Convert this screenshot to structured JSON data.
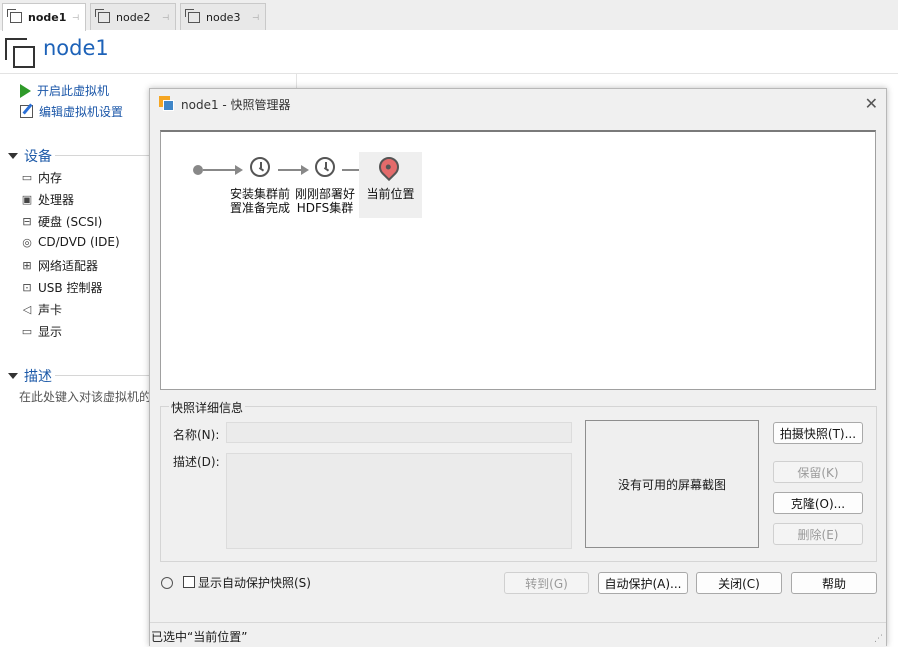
{
  "tabs": [
    {
      "label": "node1",
      "active": true
    },
    {
      "label": "node2",
      "active": false
    },
    {
      "label": "node3",
      "active": false
    }
  ],
  "header": {
    "title": "node1"
  },
  "actions": {
    "start_vm": "开启此虚拟机",
    "edit_vm": "编辑虚拟机设置"
  },
  "devices": {
    "section_title": "设备",
    "items": [
      "内存",
      "处理器",
      "硬盘 (SCSI)",
      "CD/DVD (IDE)",
      "网络适配器",
      "USB 控制器",
      "声卡",
      "显示"
    ],
    "icons": [
      "memory-icon",
      "processor-icon",
      "hard-disk-icon",
      "cd-dvd-icon",
      "network-adapter-icon",
      "usb-icon",
      "sound-card-icon",
      "display-icon"
    ]
  },
  "description": {
    "section_title": "描述",
    "placeholder": "在此处键入对该虚拟机的描述。"
  },
  "dialog": {
    "title": "node1 - 快照管理器",
    "snapshots": [
      {
        "line1": "安装集群前",
        "line2": "置准备完成"
      },
      {
        "line1": "刚刚部署好",
        "line2": "HDFS集群"
      }
    ],
    "current_location": "当前位置",
    "details": {
      "group_title": "快照详细信息",
      "name_label": "名称(N):",
      "name_value": "",
      "desc_label": "描述(D):",
      "desc_value": "",
      "no_screenshot": "没有可用的屏幕截图"
    },
    "side_buttons": {
      "take_snapshot": "拍摄快照(T)...",
      "keep": "保留(K)",
      "clone": "克隆(O)...",
      "delete": "删除(E)"
    },
    "show_autoprotect": "显示自动保护快照(S)",
    "show_autoprotect_checked": false,
    "bottom_buttons": {
      "goto": "转到(G)",
      "autoprotect": "自动保护(A)...",
      "close": "关闭(C)",
      "help": "帮助"
    },
    "status": "已选中“当前位置”"
  },
  "colors": {
    "title_blue": "#1d62b8",
    "play_green": "#2f9a2a",
    "pin_red": "#e46b6b"
  }
}
